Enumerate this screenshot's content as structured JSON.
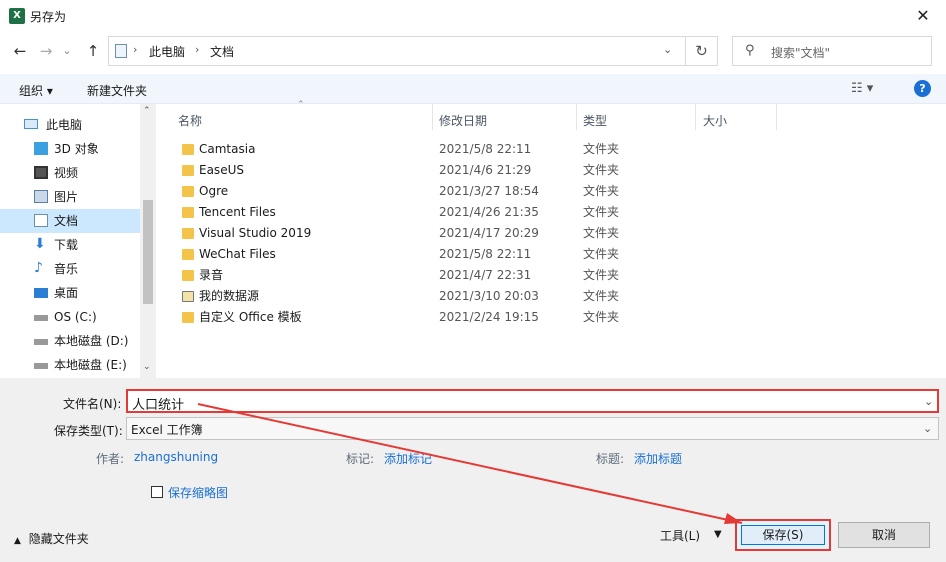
{
  "window": {
    "title": "另存为",
    "app_icon": "excel-icon",
    "close_glyph": "✕"
  },
  "nav": {
    "back_glyph": "←",
    "forward_glyph": "→",
    "recent_glyph": "⌄",
    "up_glyph": "↑",
    "breadcrumb": [
      "此电脑",
      "文档"
    ],
    "refresh_glyph": "↻",
    "search_placeholder": "搜索\"文档\""
  },
  "toolbar": {
    "organize_label": "组织 ▾",
    "new_folder_label": "新建文件夹",
    "view_glyph": "☷ ▾",
    "help_glyph": "?"
  },
  "sidebar": {
    "items": [
      {
        "label": "此电脑",
        "icon": "pc-icon",
        "color": "#4a90d9"
      },
      {
        "label": "3D 对象",
        "icon": "cube-icon",
        "color": "#3aa0e0"
      },
      {
        "label": "视频",
        "icon": "video-icon",
        "color": "#555555"
      },
      {
        "label": "图片",
        "icon": "picture-icon",
        "color": "#5b7fa8"
      },
      {
        "label": "文档",
        "icon": "document-icon",
        "color": "#6b8fb0",
        "selected": true
      },
      {
        "label": "下载",
        "icon": "download-icon",
        "color": "#2a7fd4"
      },
      {
        "label": "音乐",
        "icon": "music-icon",
        "color": "#2a7fd4"
      },
      {
        "label": "桌面",
        "icon": "desktop-icon",
        "color": "#2a7fd4"
      },
      {
        "label": "OS (C:)",
        "icon": "drive-icon",
        "color": "#777777"
      },
      {
        "label": "本地磁盘 (D:)",
        "icon": "drive-icon",
        "color": "#777777"
      },
      {
        "label": "本地磁盘 (E:)",
        "icon": "drive-icon",
        "color": "#777777"
      }
    ]
  },
  "filelist": {
    "columns": [
      "名称",
      "修改日期",
      "类型",
      "大小"
    ],
    "rows": [
      {
        "name": "Camtasia",
        "date": "2021/5/8 22:11",
        "type": "文件夹"
      },
      {
        "name": "EaseUS",
        "date": "2021/4/6 21:29",
        "type": "文件夹"
      },
      {
        "name": "Ogre",
        "date": "2021/3/27 18:54",
        "type": "文件夹"
      },
      {
        "name": "Tencent Files",
        "date": "2021/4/26 21:35",
        "type": "文件夹"
      },
      {
        "name": "Visual Studio 2019",
        "date": "2021/4/17 20:29",
        "type": "文件夹"
      },
      {
        "name": "WeChat Files",
        "date": "2021/5/8 22:11",
        "type": "文件夹"
      },
      {
        "name": "录音",
        "date": "2021/4/7 22:31",
        "type": "文件夹"
      },
      {
        "name": "我的数据源",
        "date": "2021/3/10 20:03",
        "type": "文件夹"
      },
      {
        "name": "自定义 Office 模板",
        "date": "2021/2/24 19:15",
        "type": "文件夹"
      }
    ]
  },
  "form": {
    "filename_label": "文件名(N):",
    "filename_value": "人口统计",
    "filetype_label": "保存类型(T):",
    "filetype_value": "Excel 工作簿",
    "author_label": "作者:",
    "author_value": "zhangshuning",
    "tags_label": "标记:",
    "tags_value": "添加标记",
    "title_label": "标题:",
    "title_value": "添加标题",
    "thumbnail_label": "保存缩略图"
  },
  "footer": {
    "hide_folders_label": "隐藏文件夹",
    "tools_label": "工具(L)",
    "save_label": "保存(S)",
    "cancel_label": "取消"
  },
  "colors": {
    "highlight_red": "#e53935",
    "link_blue": "#1a6fd4",
    "selected_bg": "#cce8ff"
  }
}
